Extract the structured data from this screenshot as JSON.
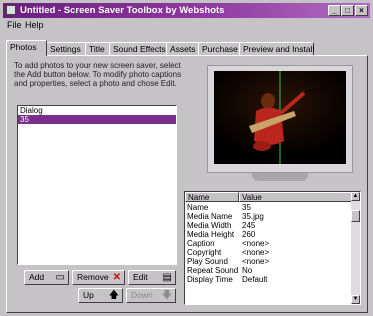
{
  "window": {
    "title": "Untitled - Screen Saver Toolbox by Webshots",
    "controls": {
      "minimize": "_",
      "maximize": "□",
      "close": "×"
    }
  },
  "menubar": {
    "items": [
      "File",
      "Help"
    ]
  },
  "tabs": [
    "Photos",
    "Settings",
    "Title",
    "Sound Effects",
    "Assets",
    "Purchase",
    "Preview and Install"
  ],
  "photos": {
    "instructions": "To add photos to your new screen saver, select the Add button below. To modify photo captions and properties, select a photo and chose Edit.",
    "list": [
      "Dialog",
      "35"
    ],
    "selected_index": 1,
    "buttons": {
      "add": "Add",
      "remove": "Remove",
      "edit": "Edit",
      "up": "Up",
      "down": "Down"
    }
  },
  "properties": {
    "headers": {
      "name": "Name",
      "value": "Value"
    },
    "rows": [
      {
        "name": "Name",
        "value": "35"
      },
      {
        "name": "Media Name",
        "value": "35.jpg"
      },
      {
        "name": "Media Width",
        "value": "245"
      },
      {
        "name": "Media Height",
        "value": "260"
      },
      {
        "name": "Caption",
        "value": "<none>"
      },
      {
        "name": "Copyright",
        "value": "<none>"
      },
      {
        "name": "Play Sound",
        "value": "<none>"
      },
      {
        "name": "Repeat Sound",
        "value": "No"
      },
      {
        "name": "Display Time",
        "value": "Default"
      }
    ]
  }
}
